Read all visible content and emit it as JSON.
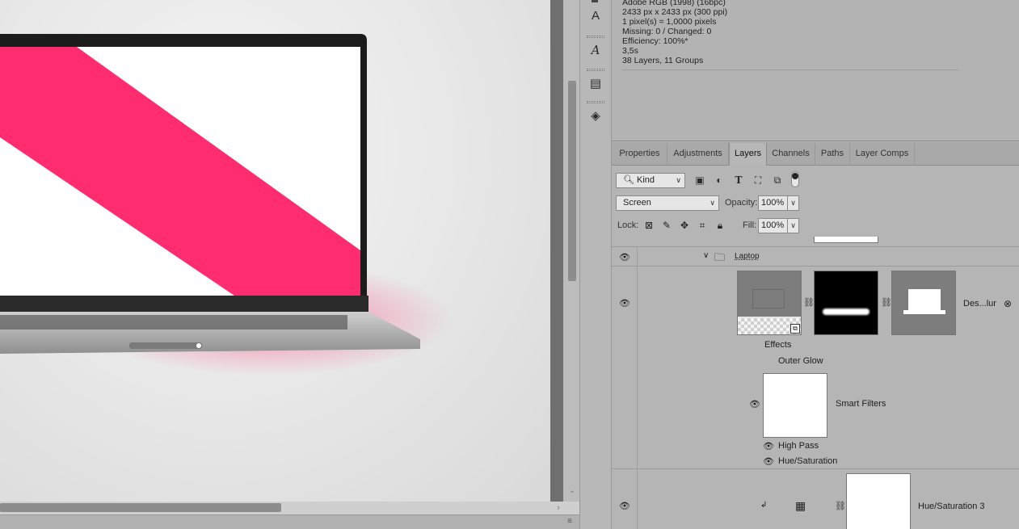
{
  "document_info": {
    "lines": [
      "Adobe RGB (1998) (16bpc)",
      "2433 px x 2433 px (300 ppi)",
      "1 pixel(s) = 1,0000 pixels",
      "Missing: 0 / Changed: 0",
      "Efficiency: 100%*",
      "3,5s",
      "38 Layers, 11 Groups"
    ]
  },
  "tools": [
    {
      "icon": "character-icon",
      "glyph": "A"
    },
    {
      "icon": "glyph-icon",
      "glyph": "𝒜"
    },
    {
      "icon": "notes-icon",
      "glyph": "▤"
    },
    {
      "icon": "3d-icon",
      "glyph": "◈"
    }
  ],
  "tabs": [
    {
      "label": "Properties",
      "active": false
    },
    {
      "label": "Adjustments",
      "active": false
    },
    {
      "label": "Layers",
      "active": true
    },
    {
      "label": "Channels",
      "active": false
    },
    {
      "label": "Paths",
      "active": false
    },
    {
      "label": "Layer Comps",
      "active": false
    }
  ],
  "layers_panel": {
    "filter_kind": "Kind",
    "blend_mode": "Screen",
    "opacity_label": "Opacity:",
    "opacity_value": "100%",
    "lock_label": "Lock:",
    "fill_label": "Fill:",
    "fill_value": "100%"
  },
  "layers": {
    "group_name": "Laptop",
    "smart_layer_name": "Des...lur",
    "effects_label": "Effects",
    "outer_glow_label": "Outer Glow",
    "smart_filters_label": "Smart Filters",
    "high_pass_label": "High Pass",
    "hue_saturation_label": "Hue/Saturation",
    "adjustment_layer_name": "Hue/Saturation 3"
  },
  "colors": {
    "accent_pink": "#ff2d6f",
    "panel_bg": "#b5b5b5"
  }
}
